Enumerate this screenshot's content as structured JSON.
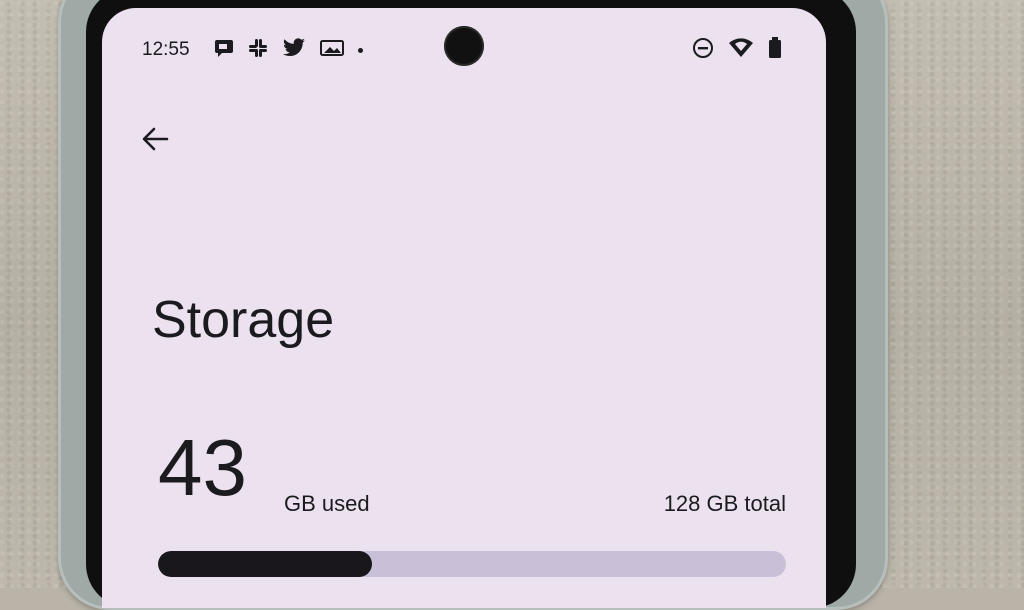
{
  "status_bar": {
    "time": "12:55",
    "notification_icons": [
      "messages-icon",
      "slack-icon",
      "twitter-icon",
      "photo-icon"
    ],
    "system_icons": [
      "do-not-disturb-icon",
      "wifi-icon",
      "battery-icon"
    ]
  },
  "page": {
    "title": "Storage",
    "used_value": "43",
    "used_unit": "GB used",
    "total": "128 GB total",
    "used_fraction": 0.34
  },
  "colors": {
    "screen_bg": "#ece1ee",
    "text": "#1b1b1f",
    "bar_track": "#c9c0d8",
    "bar_fill": "#19171c"
  }
}
